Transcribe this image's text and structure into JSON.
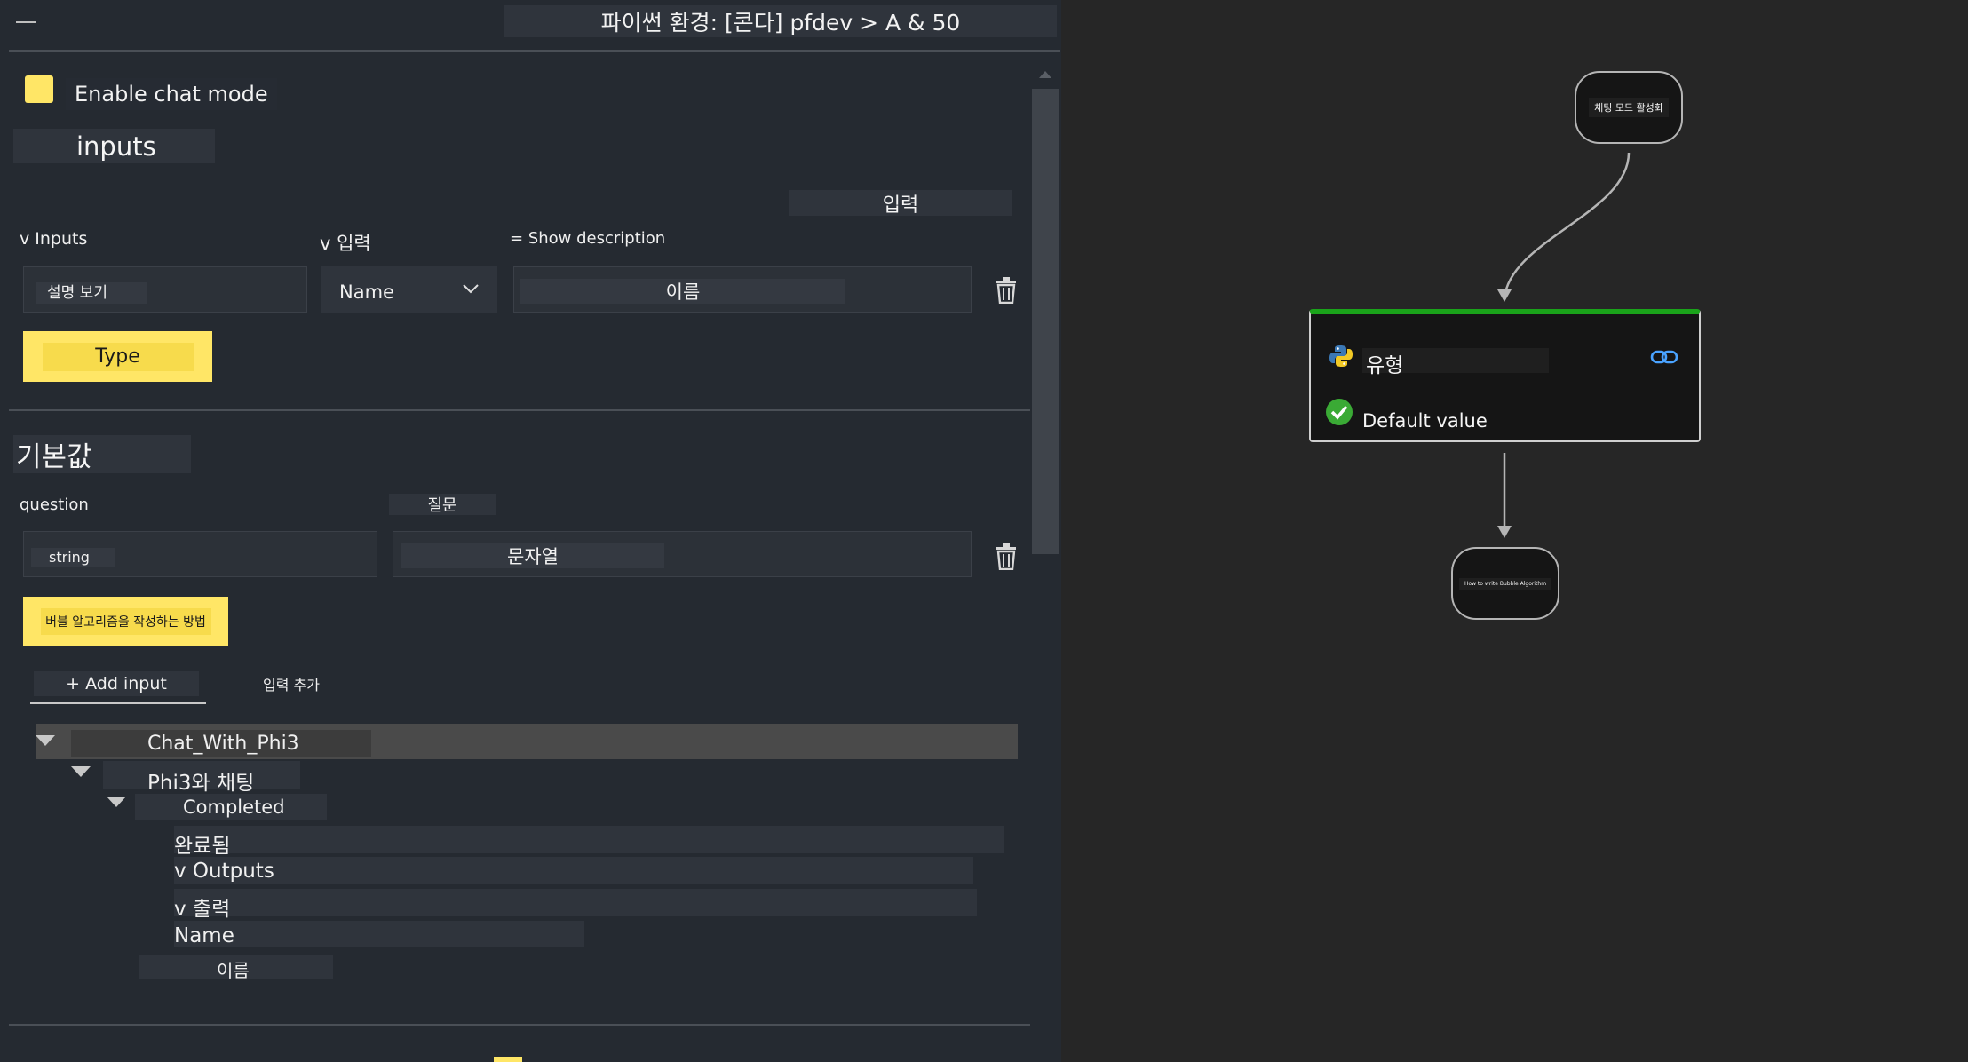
{
  "header": {
    "menu_icon": "menu-icon",
    "title": "파이썬 환경: [콘다] pfdev > A & 50"
  },
  "chat_mode": {
    "label": "Enable chat mode",
    "checkbox_color": "#FFE666"
  },
  "inputs_section": {
    "heading": "inputs",
    "korean_input_label": "입력",
    "col_inputs": "v Inputs",
    "col_input_ko": "v 입력",
    "show_description": "= Show description",
    "description_value": "설명 보기",
    "type_select": "Name",
    "name_value": "이름",
    "type_button": "Type"
  },
  "default_section": {
    "heading": "기본값",
    "question_label": "question",
    "question_ko": "질문",
    "string_value": "string",
    "string_ko": "문자열",
    "default_button": "버블 알고리즘을 작성하는 방법",
    "add_input": "+ Add input",
    "add_input_ko": "입력 추가"
  },
  "tree": {
    "root": "Chat_With_Phi3",
    "child": "Phi3와 채팅",
    "status": "Completed",
    "status_ko": "완료됨",
    "outputs": "v Outputs",
    "outputs_ko": "v 출력",
    "name": "Name",
    "name_ko": "이름"
  },
  "flow": {
    "top_node": "채팅 모드 활성화",
    "main_node_title": "유형",
    "main_node_status": "Default value",
    "bottom_node": "How to write Bubble Algorithm",
    "accent_color": "#1AA31A",
    "link_color": "#4AA3FF"
  }
}
